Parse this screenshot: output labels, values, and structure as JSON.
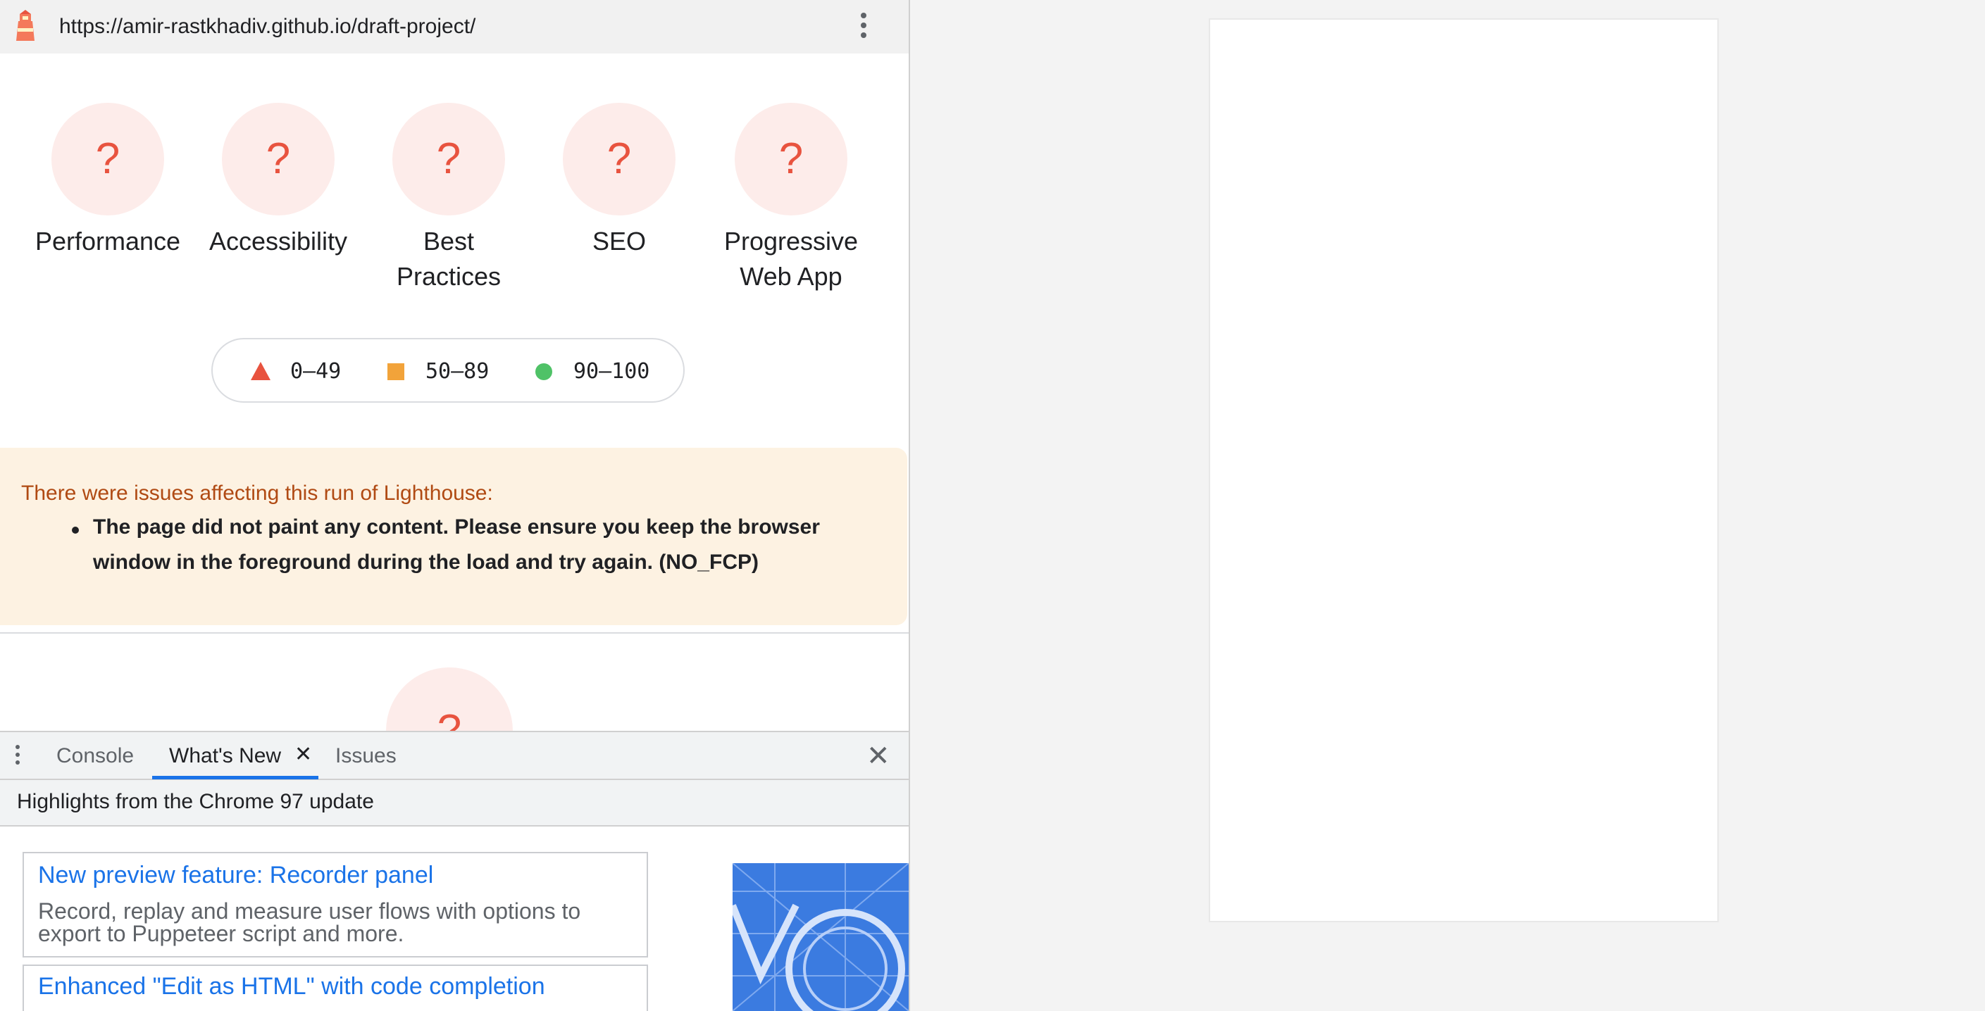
{
  "url_bar": {
    "url": "https://amir-rastkhadiv.github.io/draft-project/"
  },
  "gauges": [
    {
      "score": "?",
      "label": "Performance"
    },
    {
      "score": "?",
      "label": "Accessibility"
    },
    {
      "score": "?",
      "label": "Best Practices"
    },
    {
      "score": "?",
      "label": "SEO"
    },
    {
      "score": "?",
      "label": "Progressive Web App"
    }
  ],
  "legend": {
    "fail": "0–49",
    "average": "50–89",
    "pass": "90–100"
  },
  "colors": {
    "fail": "#e8533f",
    "average": "#f2a33a",
    "pass": "#4fc267",
    "link": "#1a73e8"
  },
  "warning": {
    "title": "There were issues affecting this run of Lighthouse:",
    "item": "The page did not paint any content. Please ensure you keep the browser window in the foreground during the load and try again. (NO_FCP)"
  },
  "next_gauge": {
    "score": "?"
  },
  "drawer": {
    "tabs": [
      "Console",
      "What's New",
      "Issues"
    ],
    "active_tab": "What's New",
    "subtitle": "Highlights from the Chrome 97 update",
    "cards": [
      {
        "title": "New preview feature: Recorder panel",
        "description": "Record, replay and measure user flows with options to export to Puppeteer script and more."
      },
      {
        "title": "Enhanced \"Edit as HTML\" with code completion",
        "description": ""
      }
    ]
  }
}
